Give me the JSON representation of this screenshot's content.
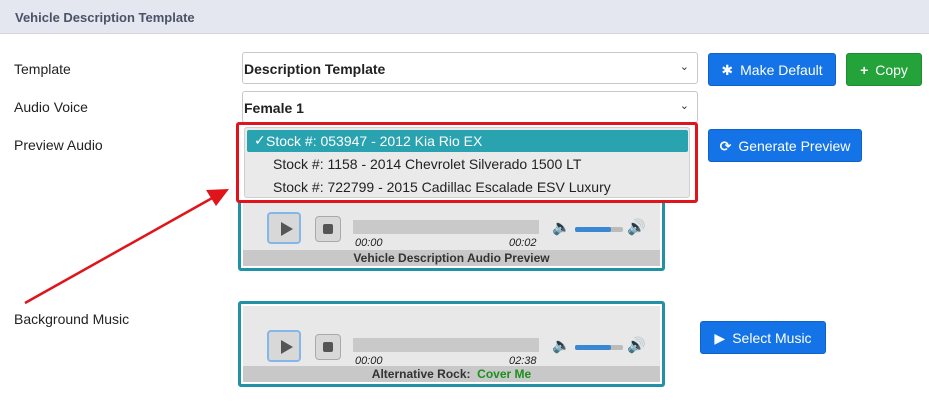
{
  "header": {
    "title": "Vehicle Description Template"
  },
  "labels": {
    "template": "Template",
    "audio_voice": "Audio Voice",
    "preview_audio": "Preview Audio",
    "background_music": "Background Music"
  },
  "template_select": {
    "value": "Description Template",
    "icon": "chevron-down-icon"
  },
  "voice_select": {
    "value": "Female 1",
    "icon": "chevron-down-icon"
  },
  "buttons": {
    "make_default": "Make Default",
    "copy": "Copy",
    "generate_preview": "Generate Preview",
    "select_music": "Select Music"
  },
  "stock_dropdown": {
    "options": [
      "Stock #: 053947 - 2012 Kia Rio EX",
      "Stock #: 1158 - 2014 Chevrolet Silverado 1500 LT",
      "Stock #: 722799 - 2015 Cadillac Escalade ESV Luxury"
    ],
    "selected_index": 0,
    "check": "✓"
  },
  "preview_player": {
    "time_current": "00:00",
    "time_total": "00:02",
    "caption": "Vehicle Description Audio Preview",
    "volume": 0.75
  },
  "music_player": {
    "time_current": "00:00",
    "time_total": "02:38",
    "caption_genre": "Alternative Rock:",
    "caption_title": "Cover Me",
    "volume": 0.75
  },
  "colors": {
    "accent_blue": "#1473e6",
    "green": "#24a33a",
    "teal": "#2191a6",
    "annotation_red": "#e0141b"
  }
}
